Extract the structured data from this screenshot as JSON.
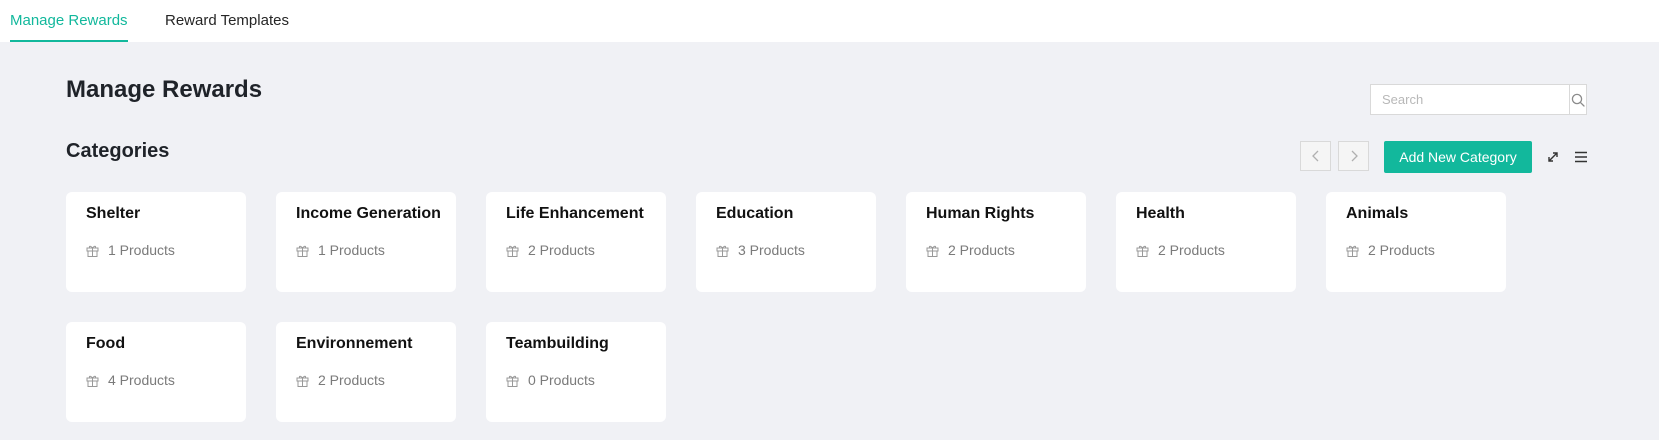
{
  "tabs": [
    {
      "label": "Manage Rewards",
      "active": true
    },
    {
      "label": "Reward Templates",
      "active": false
    }
  ],
  "page": {
    "title": "Manage Rewards"
  },
  "search": {
    "placeholder": "Search",
    "value": ""
  },
  "categories_section": {
    "title": "Categories",
    "add_button_label": "Add New Category"
  },
  "icons": {
    "search": "search-icon",
    "prev": "chevron-left-icon",
    "next": "chevron-right-icon",
    "expand": "expand-icon",
    "menu": "menu-icon",
    "product": "gift-icon"
  },
  "categories": [
    {
      "name": "Shelter",
      "products": "1 Products"
    },
    {
      "name": "Income Generation",
      "products": "1 Products"
    },
    {
      "name": "Life Enhancement",
      "products": "2 Products"
    },
    {
      "name": "Education",
      "products": "3 Products"
    },
    {
      "name": "Human Rights",
      "products": "2 Products"
    },
    {
      "name": "Health",
      "products": "2 Products"
    },
    {
      "name": "Animals",
      "products": "2 Products"
    },
    {
      "name": "Food",
      "products": "4 Products"
    },
    {
      "name": "Environnement",
      "products": "2 Products"
    },
    {
      "name": "Teambuilding",
      "products": "0 Products"
    }
  ],
  "colors": {
    "accent": "#12b89c",
    "background": "#f0f1f5",
    "card": "#ffffff",
    "muted_text": "#7a7a7a"
  }
}
